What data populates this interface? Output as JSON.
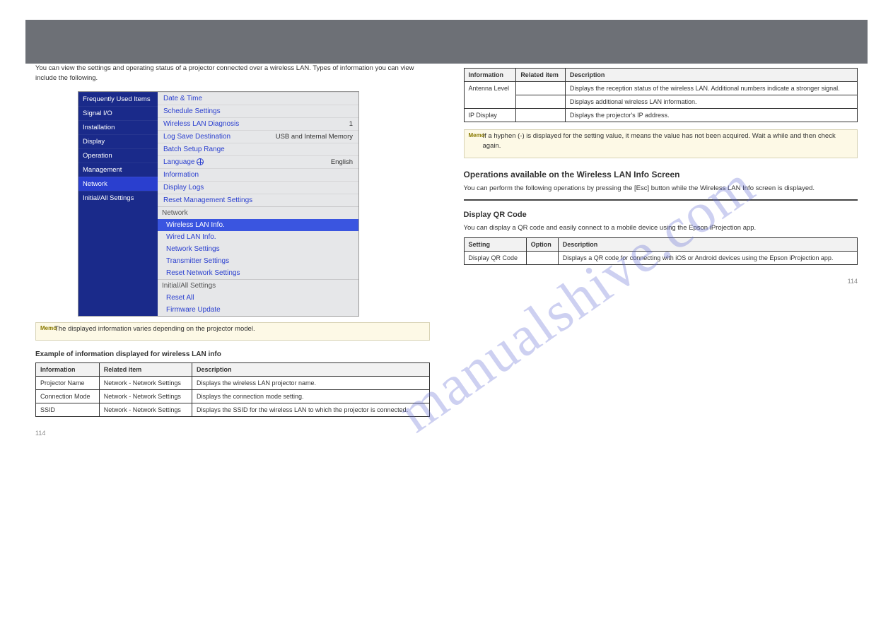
{
  "watermark": "manualshive.com",
  "header": {
    "chapter": "",
    "title": ""
  },
  "left": {
    "intro": "You can view the settings and operating status of a projector connected over a wireless LAN. Types of information you can view include the following.",
    "menu": {
      "side": [
        "Frequently Used Items",
        "Signal I/O",
        "Installation",
        "Display",
        "Operation",
        "Management",
        "Network",
        "Initial/All Settings"
      ],
      "side_active": "Network",
      "rows": [
        {
          "label": "Date & Time",
          "val": ""
        },
        {
          "label": "Schedule Settings",
          "val": ""
        },
        {
          "label": "Wireless LAN Diagnosis",
          "val": "1"
        },
        {
          "label": "Log Save Destination",
          "val": "USB and Internal Memory"
        },
        {
          "label": "Batch Setup Range",
          "val": ""
        },
        {
          "label": "Language",
          "val": "English",
          "icon": "globe"
        },
        {
          "label": "Information",
          "val": ""
        },
        {
          "label": "Display Logs",
          "val": ""
        },
        {
          "label": "Reset Management Settings",
          "val": ""
        }
      ],
      "grp1": "Network",
      "net_items": [
        "Wireless LAN Info.",
        "Wired LAN Info.",
        "Network Settings",
        "Transmitter Settings",
        "Reset Network Settings"
      ],
      "net_hl": "Wireless LAN Info.",
      "grp2": "Initial/All Settings",
      "init_items": [
        "Reset All",
        "Firmware Update"
      ]
    },
    "memo": "The displayed information varies depending on the projector model.",
    "table_title": "Example of information displayed for wireless LAN info",
    "table": {
      "headers": [
        "Information",
        "Related item",
        "Description"
      ],
      "rows": [
        [
          "Projector Name",
          "Network - Network Settings",
          "Displays the wireless LAN projector name."
        ],
        [
          "Connection Mode",
          "Network - Network Settings",
          "Displays the connection mode setting."
        ],
        [
          "SSID",
          "Network - Network Settings",
          "Displays the SSID for the wireless LAN to which the projector is connected."
        ]
      ]
    },
    "page": "114"
  },
  "right": {
    "table": {
      "headers": [
        "Information",
        "Related item",
        "Description"
      ],
      "rows": [
        [
          "Antenna Level",
          "",
          "Displays the reception status of the wireless LAN. Additional numbers indicate a stronger signal."
        ],
        [
          "",
          "",
          "Displays additional wireless LAN information."
        ],
        [
          "IP Display",
          "",
          "Displays the projector's IP address."
        ]
      ]
    },
    "memo": "If a hyphen (-) is displayed for the setting value, it means the value has not been acquired. Wait a while and then check again.",
    "heading": "Operations available on the Wireless LAN Info Screen",
    "body": "You can perform the following operations by pressing the [Esc] button while the Wireless LAN Info screen is displayed.",
    "sep_title": "Display QR Code",
    "sep_body": "You can display a QR code and easily connect to a mobile device using the Epson iProjection app.",
    "table2": {
      "headers": [
        "Setting",
        "Option",
        "Description"
      ],
      "rows": [
        [
          "Display QR Code",
          "",
          "Displays a QR code for connecting with iOS or Android devices using the Epson iProjection app."
        ]
      ]
    },
    "page": "114"
  }
}
